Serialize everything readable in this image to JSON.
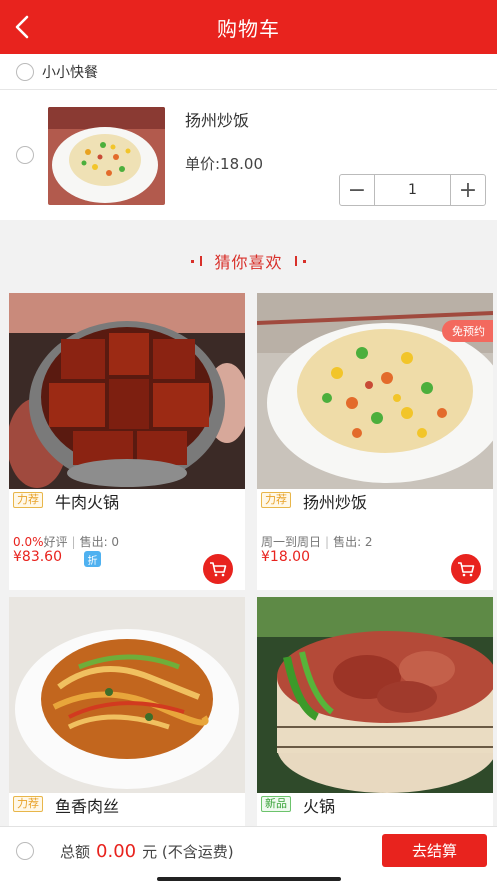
{
  "header": {
    "title": "购物车"
  },
  "shop": {
    "name": "小小快餐"
  },
  "cart_item": {
    "name": "扬州炒饭",
    "price": "单价:18.00",
    "quantity": "1",
    "minus": "−",
    "plus": "+"
  },
  "recommend": {
    "title": "猜你喜欢"
  },
  "products": [
    {
      "tag": "力荐",
      "name": "牛肉火锅",
      "rating": "0.0%",
      "rating_suffix": "好评",
      "sold": "售出: 0",
      "price": "¥83.60",
      "discount": "折"
    },
    {
      "tag": "力荐",
      "name": "扬州炒饭",
      "schedule": "周一到周日",
      "sold": "售出: 2",
      "price": "¥18.00",
      "badge": "免预约"
    },
    {
      "tag": "力荐",
      "name": "鱼香肉丝"
    },
    {
      "tag": "新品",
      "name": "火锅"
    }
  ],
  "footer": {
    "total_label": "总额",
    "total_amount": "0.00",
    "total_unit": "元 (不含运费)",
    "checkout": "去结算"
  },
  "colors": {
    "accent": "#e8231e",
    "background": "#f2f2f2"
  }
}
